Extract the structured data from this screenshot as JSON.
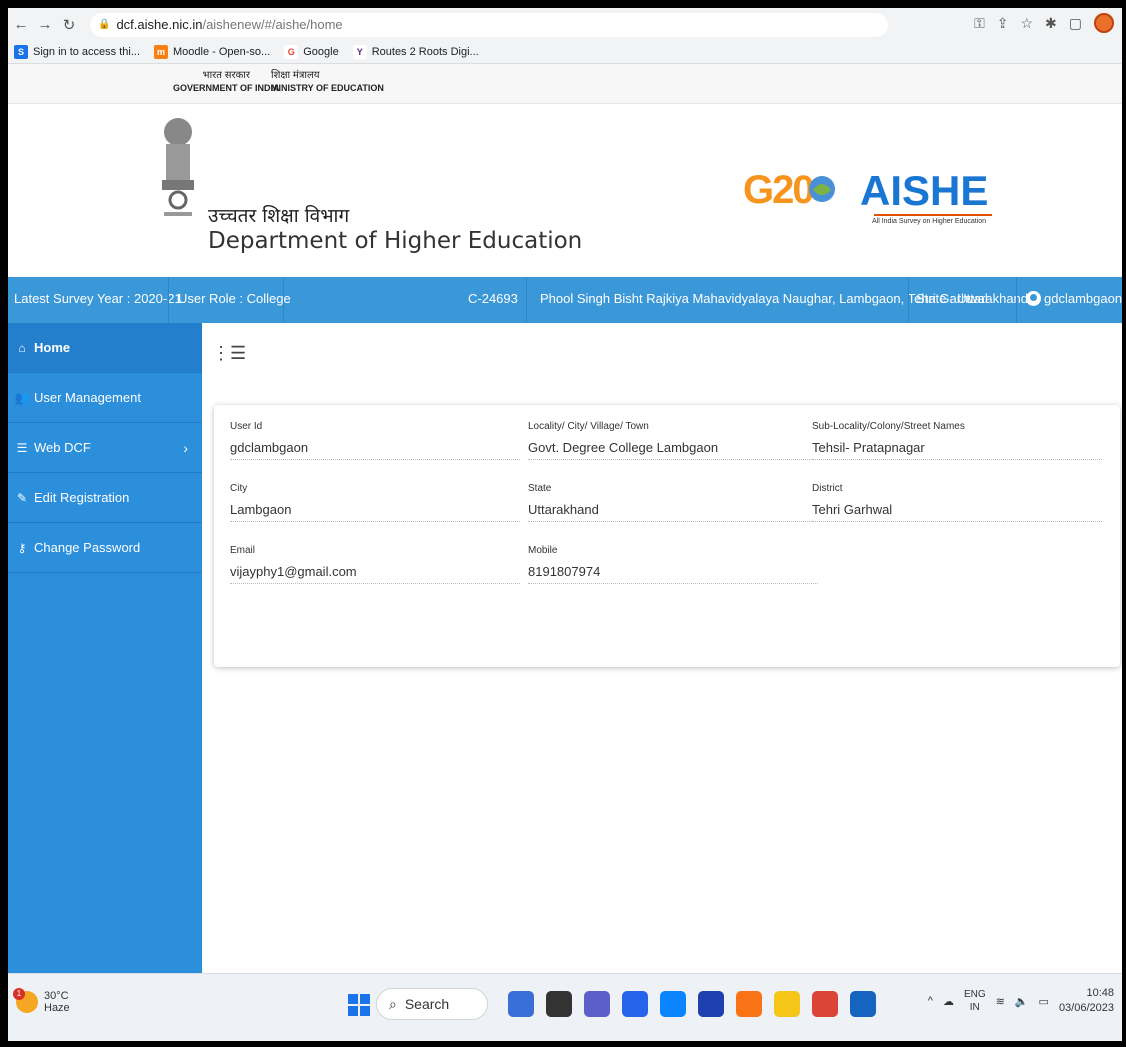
{
  "browser": {
    "url_host": "dcf.aishe.nic.in",
    "url_path": "/aishenew/#/aishe/home",
    "bookmarks": [
      {
        "label": "Sign in to access thi...",
        "icon": "s-icon",
        "color": "#1a73e8"
      },
      {
        "label": "Moodle - Open-so...",
        "icon": "moodle-icon",
        "color": "#f98012"
      },
      {
        "label": "Google",
        "icon": "google-icon",
        "color": "#ea4335"
      },
      {
        "label": "Routes 2 Roots Digi...",
        "icon": "y-icon",
        "color": "#5b2a86"
      }
    ]
  },
  "gov": {
    "hi_gov": "भारत सरकार",
    "en_gov": "GOVERNMENT OF INDIA",
    "hi_min": "शिक्षा मंत्रालय",
    "en_min": "MINISTRY OF EDUCATION"
  },
  "header": {
    "dept_hi": "उच्चतर शिक्षा विभाग",
    "dept_en": "Department of Higher Education",
    "g20_text": "G20",
    "aishe_title": "AISHE",
    "aishe_sub": "All India Survey on Higher Education"
  },
  "info_bar": {
    "survey_year": "Latest Survey Year : 2020-21",
    "user_role": "User Role : College",
    "code": "C-24693",
    "college": "Phool Singh Bisht Rajkiya Mahavidyalaya Naughar, Lambgaon, Tehri Garhwal",
    "state": "State : Uttarakhand",
    "username": "gdclambgaon"
  },
  "sidebar": {
    "items": [
      {
        "label": "Home",
        "icon": "home-icon"
      },
      {
        "label": "User Management",
        "icon": "users-icon"
      },
      {
        "label": "Web DCF",
        "icon": "list-icon"
      },
      {
        "label": "Edit Registration",
        "icon": "edit-icon"
      },
      {
        "label": "Change Password",
        "icon": "key-icon"
      }
    ]
  },
  "profile": {
    "user_id_label": "User Id",
    "user_id": "gdclambgaon",
    "locality_label": "Locality/ City/ Village/ Town",
    "locality": "Govt. Degree College Lambgaon",
    "sublocality_label": "Sub-Locality/Colony/Street Names",
    "sublocality": "Tehsil- Pratapnagar",
    "city_label": "City",
    "city": "Lambgaon",
    "state_label": "State",
    "state": "Uttarakhand",
    "district_label": "District",
    "district": "Tehri Garhwal",
    "email_label": "Email",
    "email": "vijayphy1@gmail.com",
    "mobile_label": "Mobile",
    "mobile": "8191807974"
  },
  "taskbar": {
    "temp": "30°C",
    "weather": "Haze",
    "weather_badge": "1",
    "search": "Search",
    "lang_top": "ENG",
    "lang_bottom": "IN",
    "time": "10:48",
    "date": "03/06/2023"
  },
  "colors": {
    "info_bar": "#3a97d8",
    "sidebar": "#2b8fdc",
    "aishe_blue": "#1976d2",
    "g20_orange": "#f7941d"
  }
}
